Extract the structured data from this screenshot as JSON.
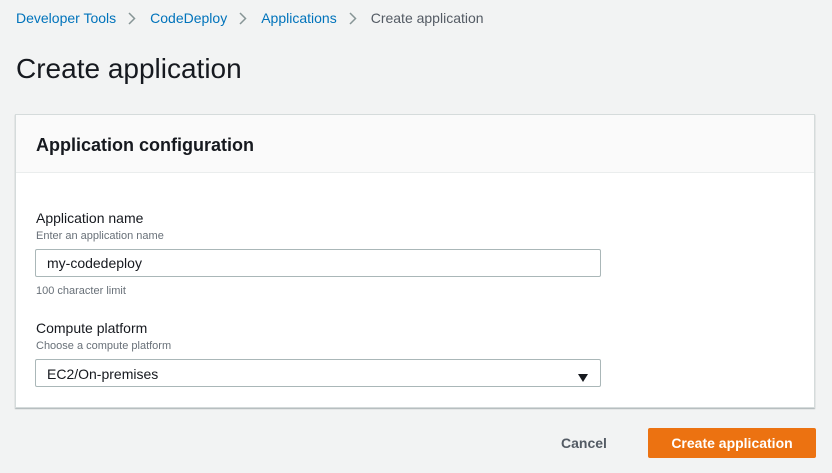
{
  "breadcrumb": {
    "items": [
      "Developer Tools",
      "CodeDeploy",
      "Applications"
    ],
    "current": "Create application"
  },
  "page": {
    "title": "Create application"
  },
  "panel": {
    "title": "Application configuration",
    "fields": {
      "app_name": {
        "label": "Application name",
        "description": "Enter an application name",
        "value": "my-codedeploy",
        "constraint": "100 character limit"
      },
      "compute_platform": {
        "label": "Compute platform",
        "description": "Choose a compute platform",
        "selected": "EC2/On-premises"
      }
    }
  },
  "actions": {
    "cancel_label": "Cancel",
    "submit_label": "Create application"
  },
  "colors": {
    "link": "#0073bb",
    "primary": "#ec7211",
    "background": "#f2f3f3"
  },
  "icons": {
    "separator": "chevron-right-icon",
    "select": "caret-down-icon"
  }
}
